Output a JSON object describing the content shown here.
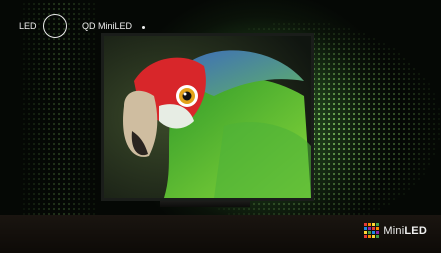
{
  "legend": {
    "led_label": "LED",
    "qd_label": "QD MiniLED"
  },
  "brand": {
    "prefix": "Mini",
    "suffix": "LED",
    "grid_colors": [
      "#e53935",
      "#fb8c00",
      "#fdd835",
      "#43a047",
      "#1e88e5",
      "#8e24aa",
      "#e53935",
      "#fb8c00",
      "#fdd835",
      "#43a047",
      "#1e88e5",
      "#8e24aa",
      "#e53935",
      "#fb8c00",
      "#fdd835",
      "#43a047"
    ]
  },
  "colors": {
    "accent_green": "#8bd36b",
    "glow": "#3a6a2a"
  },
  "image_subject": "parrot-photo"
}
